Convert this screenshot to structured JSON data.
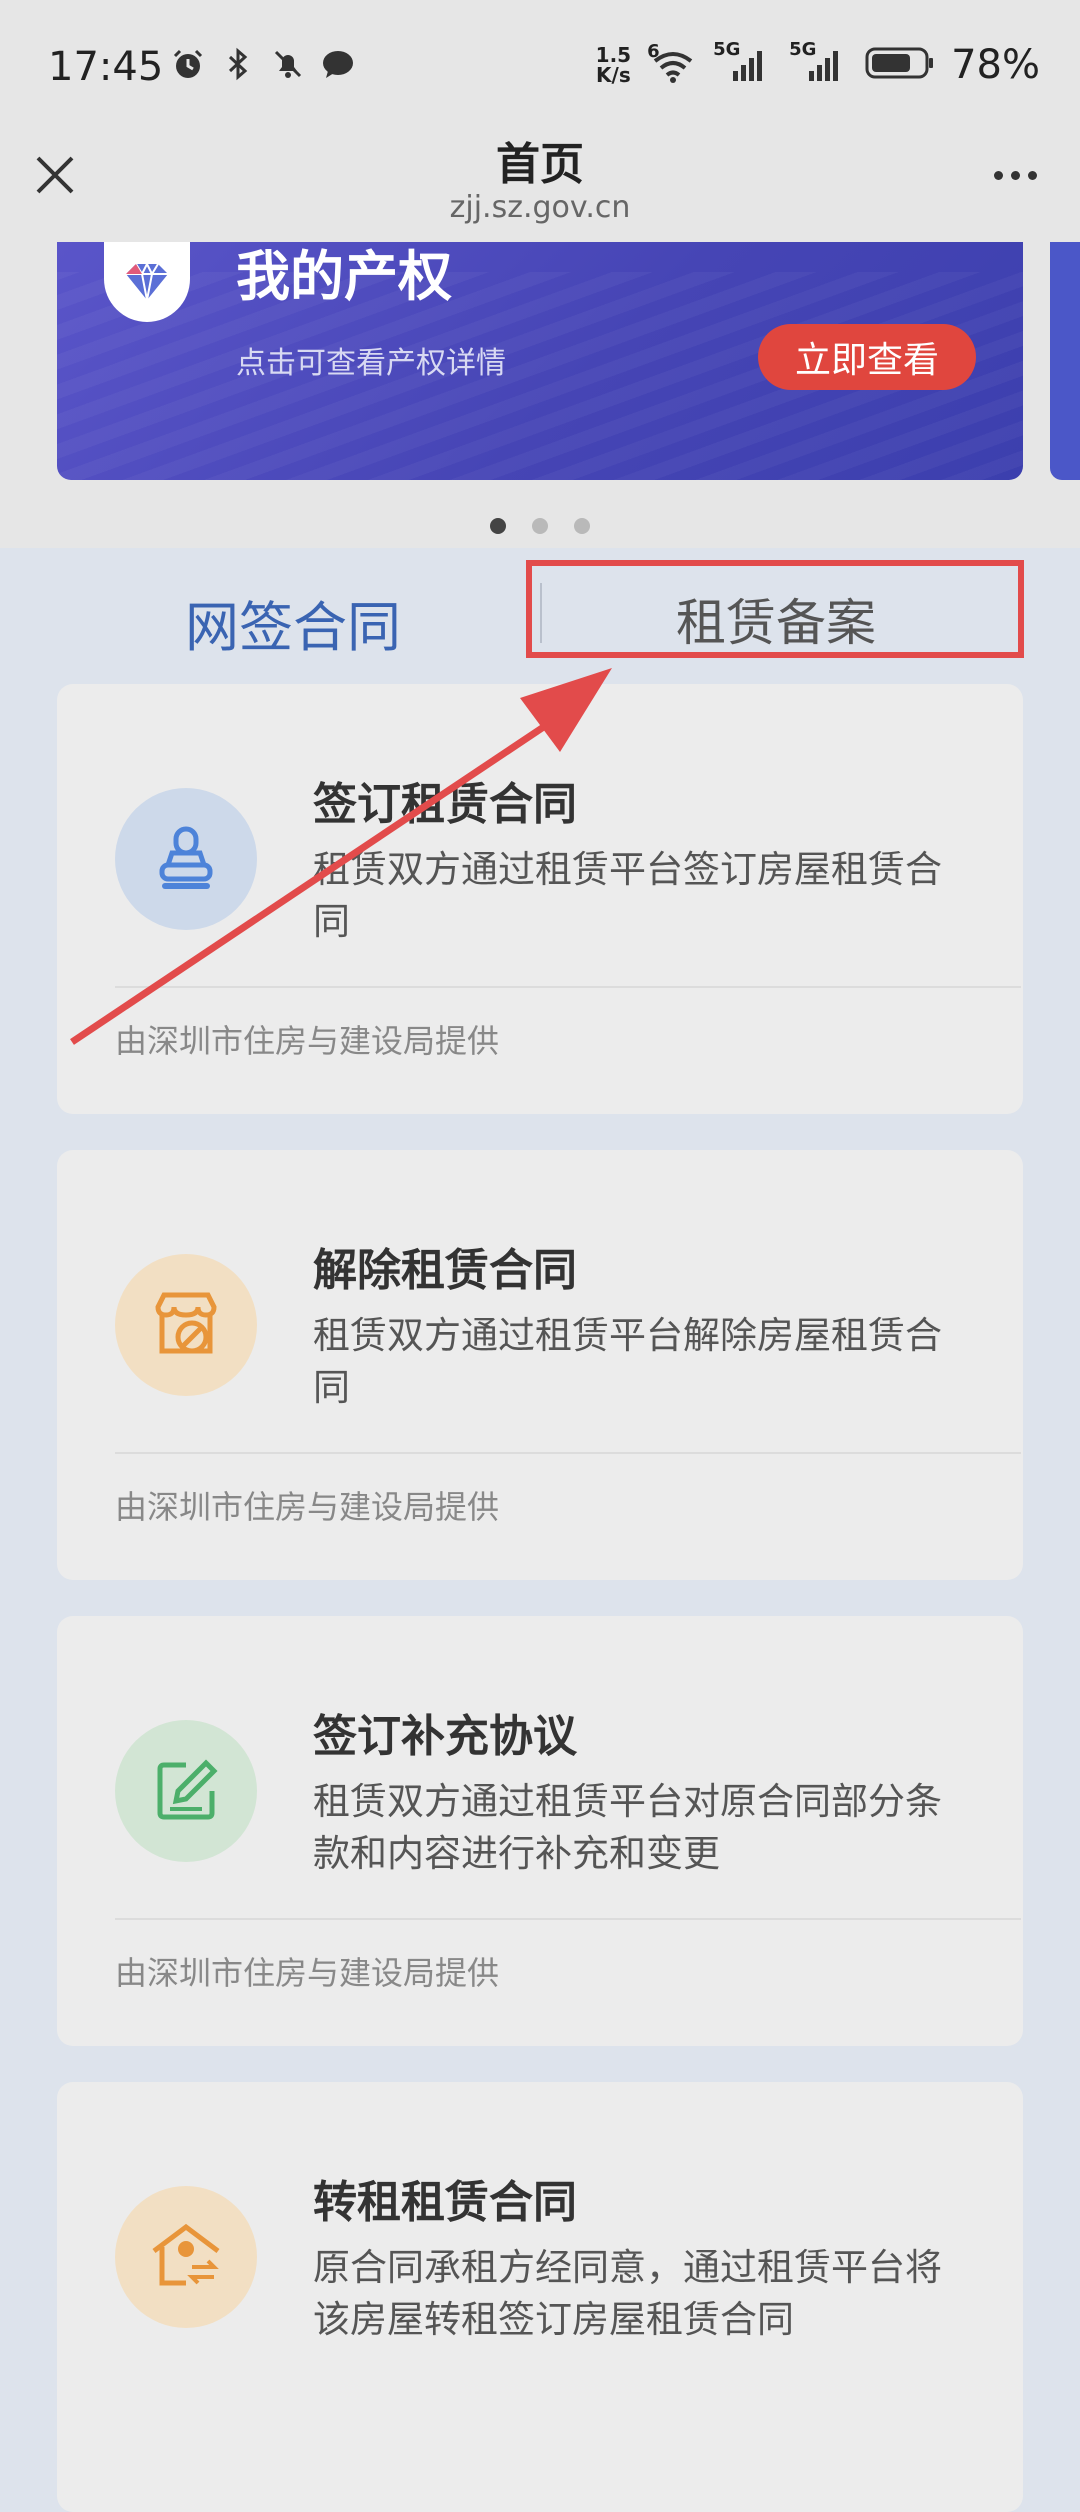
{
  "status_bar": {
    "time": "17:45",
    "net_speed_value": "1.5",
    "net_speed_unit": "K/s",
    "signal1_label": "5G",
    "signal2_label": "5G",
    "wifi_label": "6",
    "battery": "78%"
  },
  "header": {
    "title": "首页",
    "url": "zjj.sz.gov.cn"
  },
  "banner": {
    "title": "我的产权",
    "subtitle": "点击可查看产权详情",
    "button": "立即查看"
  },
  "tabs": [
    {
      "label": "网签合同"
    },
    {
      "label": "租赁备案"
    }
  ],
  "cards": [
    {
      "title": "签订租赁合同",
      "desc": "租赁双方通过租赁平台签订房屋租赁合同",
      "provider": "由深圳市住房与建设局提供",
      "icon": "stamp-icon",
      "icon_bg": "#cdd9ea",
      "icon_color": "#4d83d9"
    },
    {
      "title": "解除租赁合同",
      "desc": "租赁双方通过租赁平台解除房屋租赁合同",
      "provider": "由深圳市住房与建设局提供",
      "icon": "store-cancel-icon",
      "icon_bg": "#f2dfc3",
      "icon_color": "#e8953a"
    },
    {
      "title": "签订补充协议",
      "desc": "租赁双方通过租赁平台对原合同部分条款和内容进行补充和变更",
      "provider": "由深圳市住房与建设局提供",
      "icon": "edit-icon",
      "icon_bg": "#d2e5d4",
      "icon_color": "#4caf6a"
    },
    {
      "title": "转租租赁合同",
      "desc": "原合同承租方经同意，通过租赁平台将该房屋转租签订房屋租赁合同",
      "provider": "",
      "icon": "house-transfer-icon",
      "icon_bg": "#f2dfc3",
      "icon_color": "#e8953a"
    }
  ],
  "colors": {
    "accent": "#3a64b2",
    "highlight": "#e24b4b",
    "banner": "#4645b5"
  }
}
